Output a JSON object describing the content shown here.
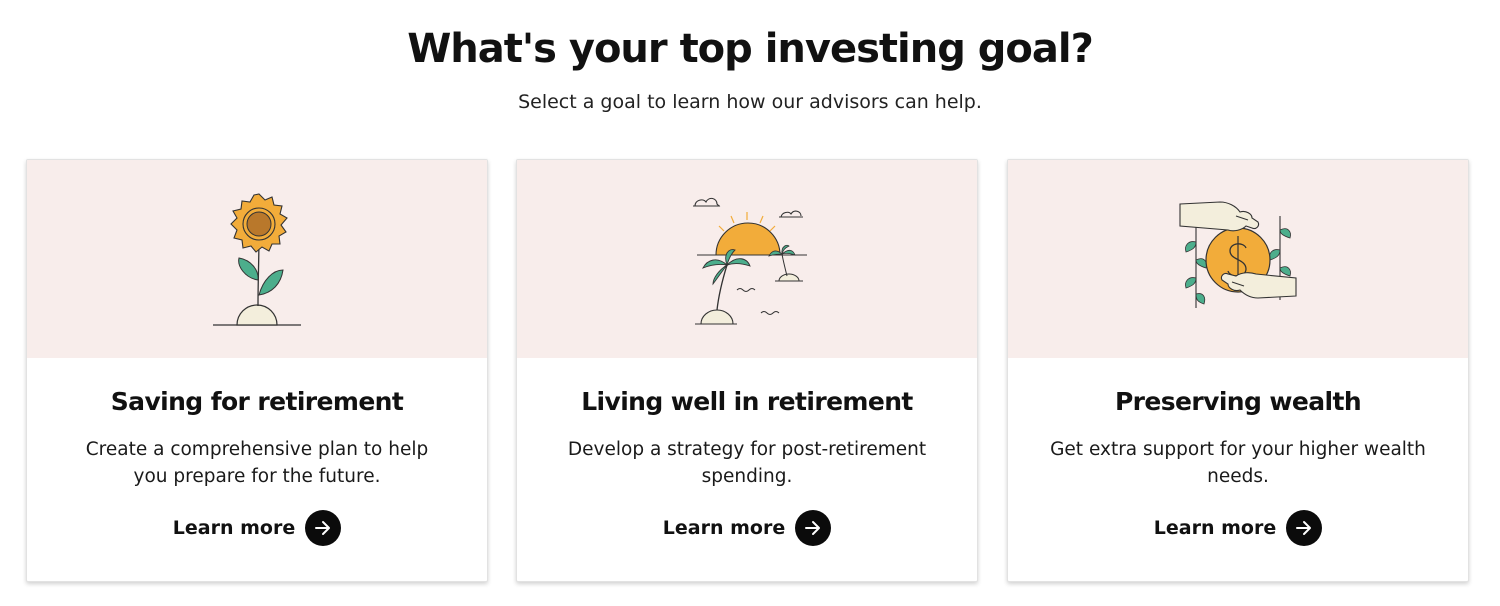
{
  "header": {
    "title": "What's your top investing goal?",
    "subtitle": "Select a goal to learn how our advisors can help."
  },
  "cards": [
    {
      "illustration": "sunflower-icon",
      "title": "Saving for retirement",
      "description": "Create a comprehensive plan to help you prepare for the future.",
      "cta": "Learn more"
    },
    {
      "illustration": "beach-sunset-icon",
      "title": "Living well in retirement",
      "description": "Develop a strategy for post-retirement spending.",
      "cta": "Learn more"
    },
    {
      "illustration": "coin-in-hands-icon",
      "title": "Preserving wealth",
      "description": "Get extra support for your higher wealth needs.",
      "cta": "Learn more"
    }
  ],
  "colors": {
    "illustration_bg": "#f8edeb",
    "accent_orange": "#f2ac3a",
    "leaf_green": "#4cae8c",
    "cream": "#f3eedc",
    "arrow_button": "#0b0b0b"
  }
}
